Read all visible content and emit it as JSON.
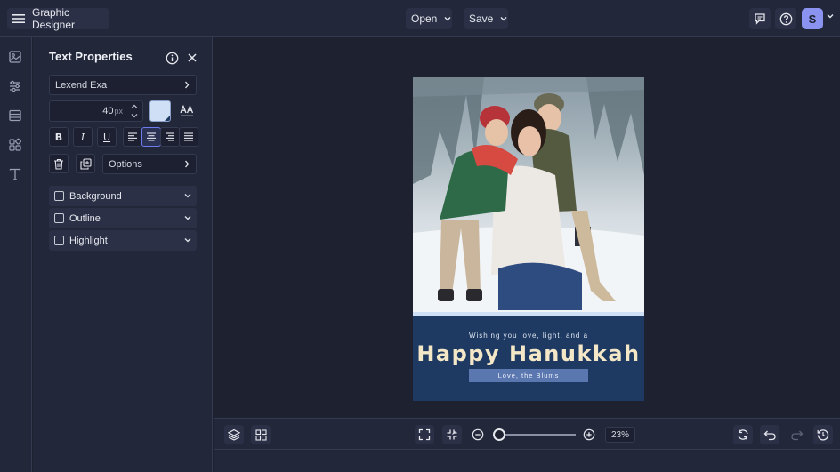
{
  "topbar": {
    "app_title": "Graphic Designer",
    "open_label": "Open",
    "save_label": "Save",
    "avatar_initial": "S"
  },
  "rail": {
    "icons": [
      "image-icon",
      "sliders-icon",
      "layout-icon",
      "shapes-icon",
      "text-icon"
    ]
  },
  "panel": {
    "title": "Text Properties",
    "font_name": "Lexend Exa",
    "font_size": "40",
    "font_size_unit": "px",
    "swatch_color": "#cfe0f6",
    "options_label": "Options",
    "accordions": [
      "Background",
      "Outline",
      "Highlight"
    ]
  },
  "card": {
    "line1": "Wishing you love, light, and a",
    "headline": "Happy Hanukkah",
    "signoff": "Love, the Blums",
    "background_color": "#1e3a62",
    "signoff_bg": "#5b77b0"
  },
  "bottombar": {
    "zoom_value": "23%"
  },
  "colors": {
    "accent": "#8a93f0",
    "panel_bg": "#22273a",
    "canvas_bg": "#1d2130"
  }
}
